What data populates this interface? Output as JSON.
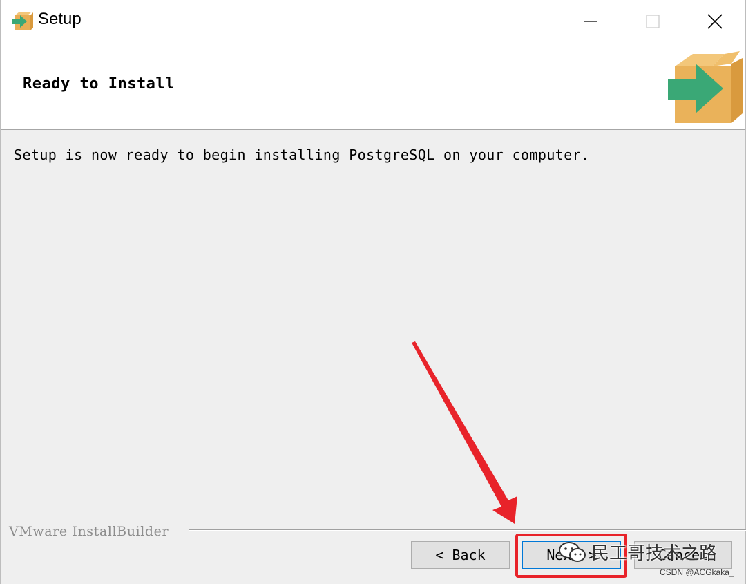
{
  "window": {
    "title": "Setup",
    "controls": {
      "minimize_icon": "minimize-icon",
      "maximize_icon": "maximize-icon",
      "close_icon": "close-icon"
    }
  },
  "header": {
    "title": "Ready to Install",
    "icon": "installer-box-arrow-icon"
  },
  "body": {
    "message": "Setup is now ready to begin installing PostgreSQL on your computer."
  },
  "footer": {
    "brand": "VMware InstallBuilder",
    "buttons": {
      "back_label": "< Back",
      "next_label": "Next >",
      "cancel_label": "Cancel"
    }
  },
  "annotation": {
    "highlight_color": "#e8232a",
    "target": "next-button"
  },
  "watermarks": {
    "wechat_text": "民工哥技术之路",
    "csdn_text": "CSDN @ACGkaka_"
  },
  "colors": {
    "title_bar_bg": "#ffffff",
    "dialog_bg": "#efefef",
    "button_bg": "#e1e1e1",
    "focus_border": "#0078d7",
    "arrow_green": "#3aa876",
    "box_orange": "#eab25a"
  }
}
